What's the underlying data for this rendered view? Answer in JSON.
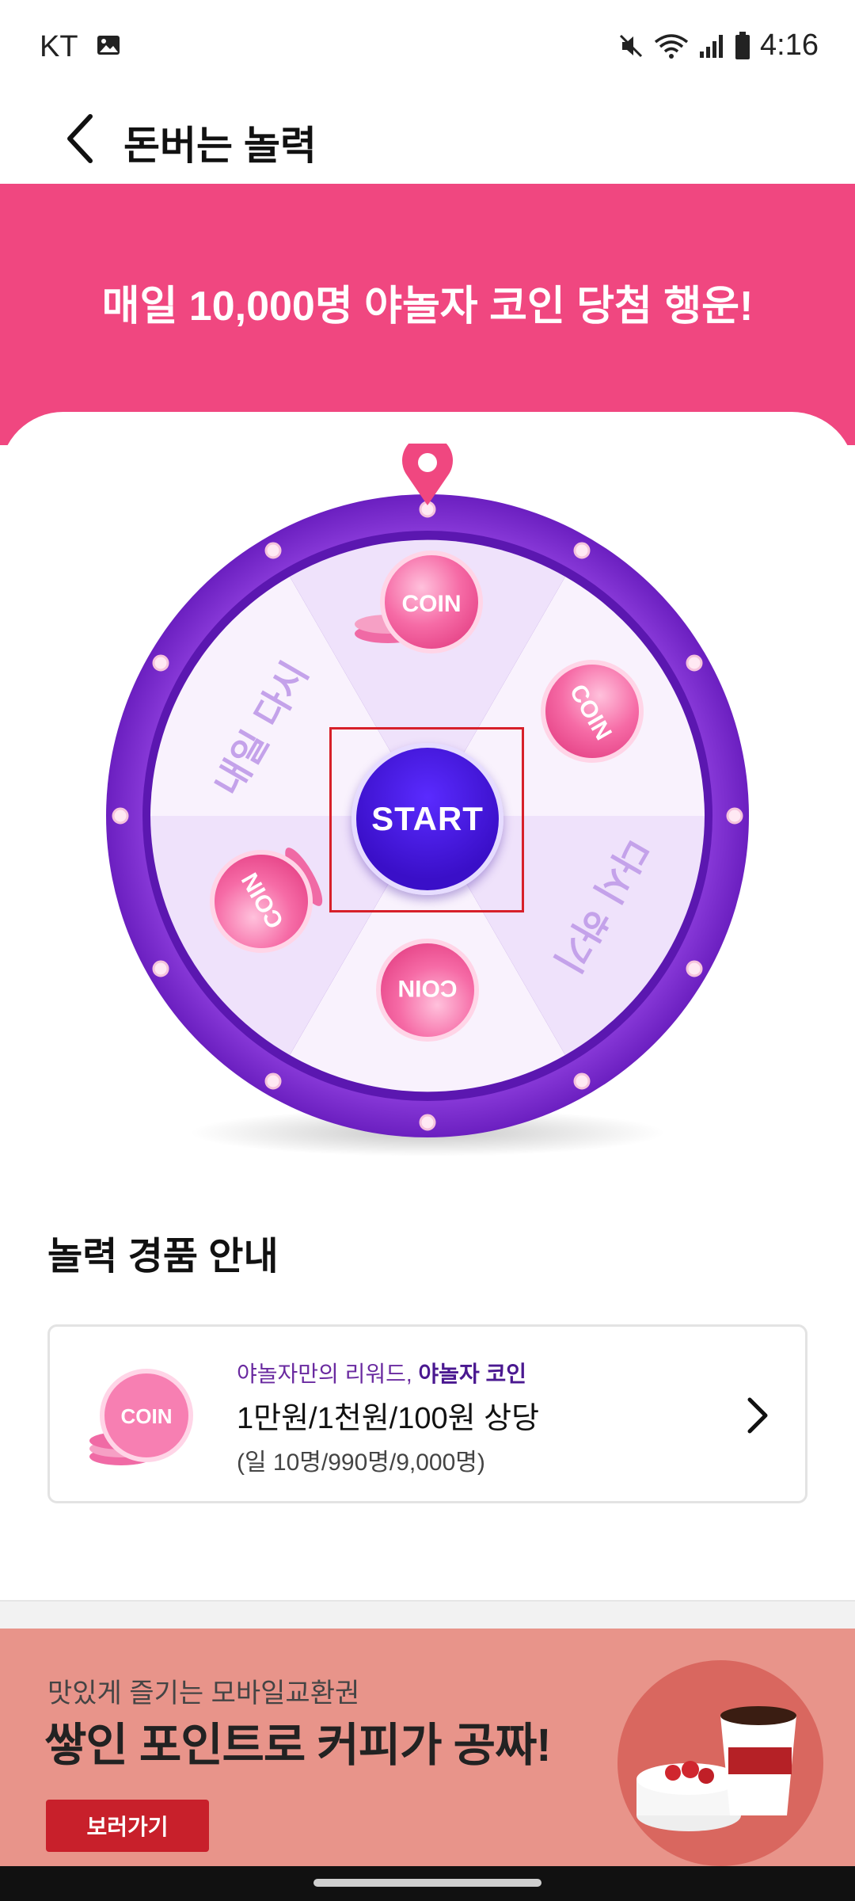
{
  "status_bar": {
    "carrier": "KT",
    "time": "4:16"
  },
  "app_bar": {
    "title": "돈버는 놀력"
  },
  "banner": {
    "headline": "매일 10,000명 야놀자 코인 당첨 행운!",
    "color": "#f04780"
  },
  "wheel": {
    "start_label": "START",
    "segments": [
      {
        "label": "COIN"
      },
      {
        "label": "COIN"
      },
      {
        "label": "다시 하기"
      },
      {
        "label": "COIN"
      },
      {
        "label": "COIN"
      },
      {
        "label": "내일 다시"
      }
    ],
    "ring_color": "#7b2fd0",
    "start_color": "#4416e0"
  },
  "prize_section": {
    "title": "놀력 경품 안내",
    "card": {
      "subtitle_prefix": "야놀자만의 리워드,",
      "subtitle_highlight": "야놀자 코인",
      "main": "1만원/1천원/100원 상당",
      "note": "(일 10명/990명/9,000명)",
      "coin_label": "COIN"
    }
  },
  "ad": {
    "subtitle": "맛있게 즐기는 모바일교환권",
    "title": "쌓인 포인트로 커피가 공짜!",
    "button": "보러가기",
    "color": "#e8948a"
  }
}
